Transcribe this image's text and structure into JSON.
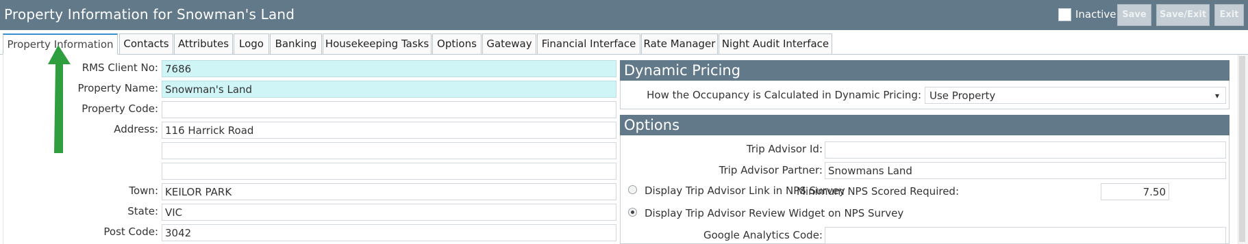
{
  "header": {
    "title": "Property Information for Snowman's Land",
    "inactive_label": "Inactive",
    "save_label": "Save",
    "save_exit_label": "Save/Exit",
    "exit_label": "Exit"
  },
  "tabs": [
    {
      "label": "Property Information",
      "active": true
    },
    {
      "label": "Contacts"
    },
    {
      "label": "Attributes"
    },
    {
      "label": "Logo"
    },
    {
      "label": "Banking"
    },
    {
      "label": "Housekeeping Tasks"
    },
    {
      "label": "Options"
    },
    {
      "label": "Gateway"
    },
    {
      "label": "Financial Interface"
    },
    {
      "label": "Rate Manager"
    },
    {
      "label": "Night Audit Interface"
    }
  ],
  "property": {
    "client_no_label": "RMS Client No:",
    "client_no_value": "7686",
    "name_label": "Property Name:",
    "name_value": "Snowman's Land",
    "code_label": "Property Code:",
    "code_value": "",
    "address_label": "Address:",
    "address_line1": "116 Harrick Road",
    "address_line2": "",
    "address_line3": "",
    "town_label": "Town:",
    "town_value": "KEILOR PARK",
    "state_label": "State:",
    "state_value": "VIC",
    "postcode_label": "Post Code:",
    "postcode_value": "3042"
  },
  "dynamic_pricing": {
    "heading": "Dynamic Pricing",
    "occupancy_label": "How the Occupancy is Calculated in Dynamic Pricing:",
    "occupancy_value": "Use Property"
  },
  "options": {
    "heading": "Options",
    "trip_advisor_id_label": "Trip Advisor Id:",
    "trip_advisor_id_value": "",
    "trip_advisor_partner_label": "Trip Advisor Partner:",
    "trip_advisor_partner_value": "Snowmans Land",
    "display_link_label": "Display Trip Advisor Link in NPS Survey",
    "display_link_selected": false,
    "min_nps_label": "Minimum NPS Scored Required:",
    "min_nps_value": "7.50",
    "display_widget_label": "Display Trip Advisor Review Widget on NPS Survey",
    "display_widget_selected": true,
    "google_analytics_label": "Google Analytics Code:",
    "google_analytics_value": ""
  },
  "colors": {
    "header_bg": "#62798a",
    "highlight_field": "#cff5f7",
    "annotation_arrow": "#2e9e3f"
  },
  "icons": {
    "select_arrow": "▾"
  }
}
